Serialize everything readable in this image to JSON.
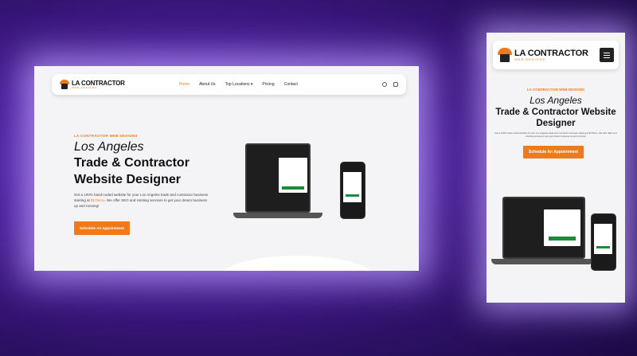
{
  "brand": {
    "name": "LA CONTRACTOR",
    "tagline": "WEB DESIGNS"
  },
  "desktop": {
    "nav": [
      {
        "label": "Home",
        "active": true
      },
      {
        "label": "About Us"
      },
      {
        "label": "Top Locations ▾"
      },
      {
        "label": "Pricing"
      },
      {
        "label": "Contact"
      }
    ],
    "eyebrow": "LA CONTRACTOR WEB DESIGNS",
    "heading_italic": "Los Angeles",
    "heading_line1": "Trade & Contractor",
    "heading_line2": "Website Designer",
    "desc_before": "Get a 100% hand-coded website for your Los Angeles trade and contractor business starting at ",
    "price": "$175/mo",
    "desc_after": ". We offer SEO and Hosting services to get your dream business up and running!",
    "cta": "Schedule An Appointment"
  },
  "mobile": {
    "eyebrow": "LA CONTRACTOR WEB DESIGNS",
    "heading_italic": "Los Angeles",
    "heading_line1": "Trade & Contractor Website",
    "heading_line2": "Designer",
    "desc": "Get a 100% hand-coded website for your Los Angeles trade and contractor business starting at $175/mo. We offer SEO and Hosting services to get your dream business up and running!",
    "cta": "Schedule An Appointment"
  },
  "colors": {
    "accent": "#f07a1a",
    "background": "#4a1f9a",
    "green": "#1f8a3a"
  }
}
